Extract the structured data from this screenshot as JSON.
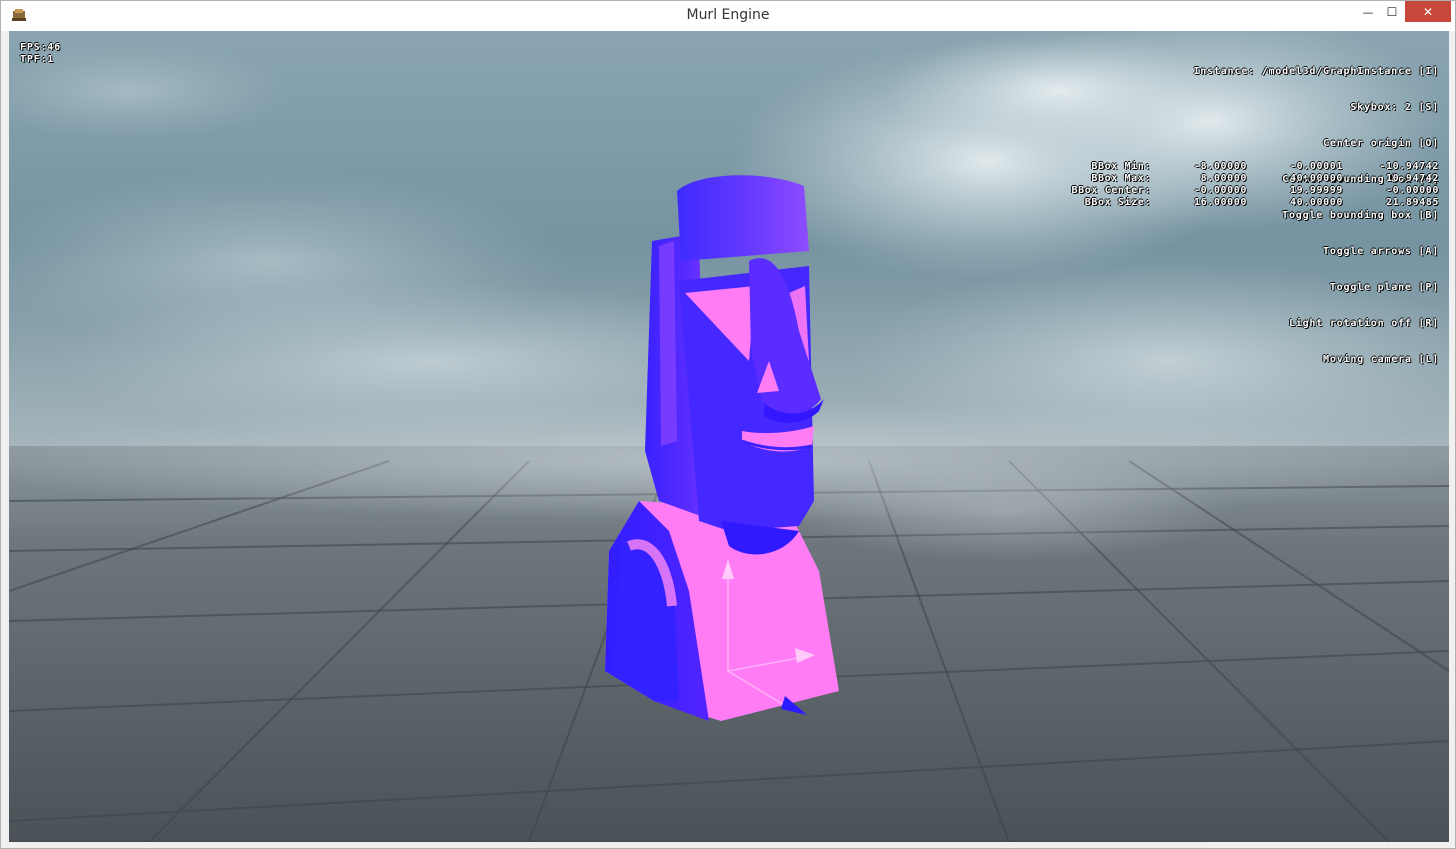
{
  "window": {
    "title": "Murl Engine",
    "minimize_glyph": "—",
    "maximize_glyph": "☐",
    "close_glyph": "✕"
  },
  "hud_left": {
    "fps": "FPS:46",
    "tpf": "TPF:1"
  },
  "hud_right": [
    "Instance: /model3d/GraphInstance [I]",
    "Skybox: 2 [S]",
    "Center origin [O]",
    "Center bounding box [C]",
    "Toggle bounding box [B]",
    "Toggle arrows [A]",
    "Toggle plane [P]",
    "Light rotation off [R]",
    "Moving camera [L]"
  ],
  "bbox": {
    "min": {
      "label": "BBox Min:",
      "x": "-8.00000",
      "y": "-0.00001",
      "z": "-10.94742"
    },
    "max": {
      "label": "BBox Max:",
      "x": "8.00000",
      "y": "40.00000",
      "z": "10.94742"
    },
    "center": {
      "label": "BBox Center:",
      "x": "-0.00000",
      "y": "19.99999",
      "z": "-0.00000"
    },
    "size": {
      "label": "BBox Size:",
      "x": "16.00000",
      "y": "40.00000",
      "z": "21.89485"
    }
  },
  "colors": {
    "model_blue": "#3a22ff",
    "model_pink": "#ff7cf5",
    "sky": "#7a97a4",
    "ground": "#5d6469"
  },
  "icons": [
    "app-icon",
    "minimize-icon",
    "maximize-icon",
    "close-icon"
  ]
}
